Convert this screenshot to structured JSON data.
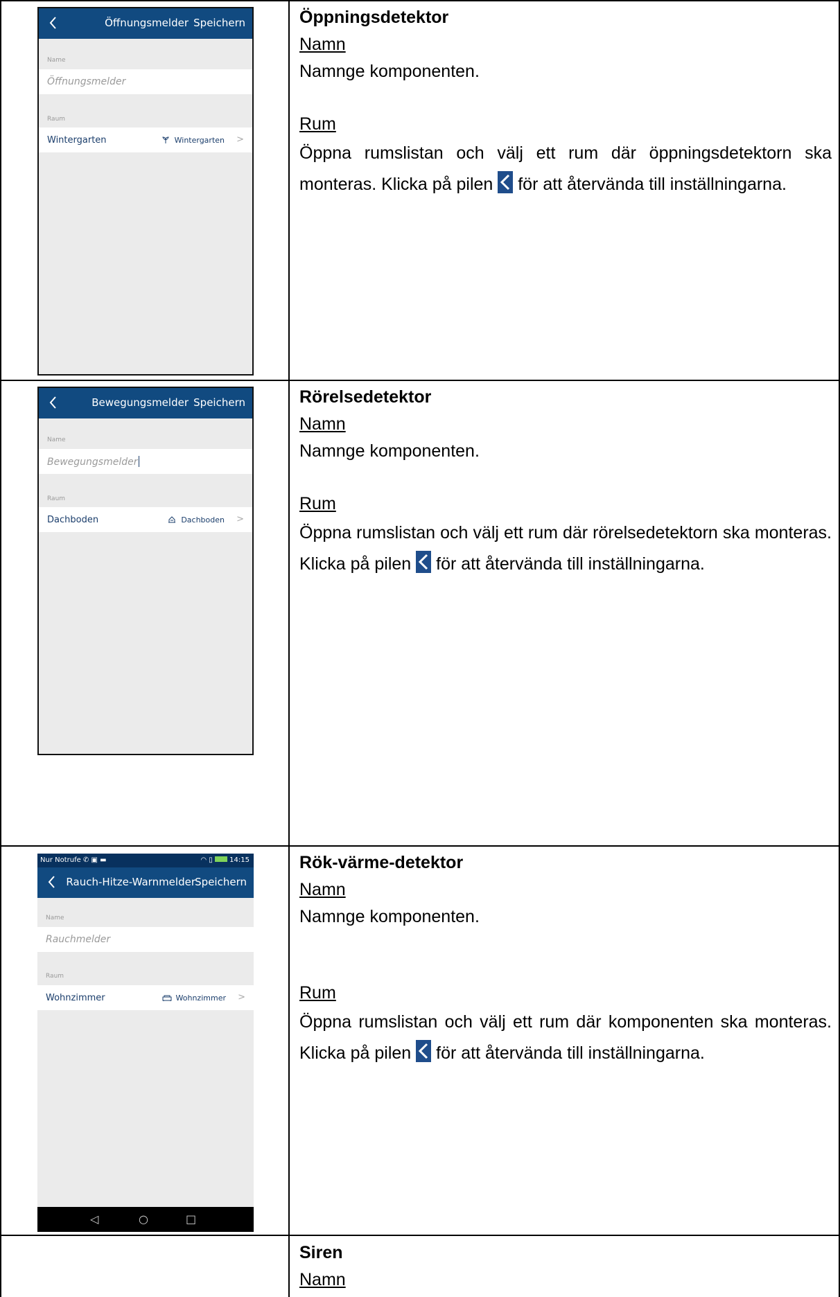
{
  "colors": {
    "accent": "#114a80",
    "icon_bg": "#1f4d8b"
  },
  "rows": [
    {
      "phone": {
        "title": "Öffnungsmelder",
        "save": "Speichern",
        "name_label": "Name",
        "name_value": "Öffnungsmelder",
        "room_label": "Raum",
        "room_name": "Wintergarten",
        "room_value": "Wintergarten",
        "room_icon": "plant-icon"
      },
      "heading": "Öppningsdetektor",
      "name_heading": "Namn",
      "name_text": "Namnge komponenten.",
      "room_heading": "Rum",
      "room_text_a": "Öppna rumslistan och välj ett rum där öppningsdetektorn ska monteras. Klicka på pilen",
      "room_text_b": "för att återvända till inställningarna."
    },
    {
      "phone": {
        "title": "Bewegungsmelder",
        "save": "Speichern",
        "name_label": "Name",
        "name_value": "Bewegungsmelder",
        "room_label": "Raum",
        "room_name": "Dachboden",
        "room_value": "Dachboden",
        "room_icon": "attic-icon"
      },
      "heading": "Rörelsedetektor",
      "name_heading": "Namn",
      "name_text": "Namnge komponenten.",
      "room_heading": "Rum",
      "room_text_a": "Öppna rumslistan och välj ett rum där rörelsedetektorn ska monteras. Klicka på pilen",
      "room_text_b": "för att återvända till inställningarna."
    },
    {
      "phone": {
        "status_left": "Nur Notrufe",
        "status_time": "14:15",
        "title": "Rauch-Hitze-Warnmelder",
        "save": "Speichern",
        "name_label": "Name",
        "name_value": "Rauchmelder",
        "room_label": "Raum",
        "room_name": "Wohnzimmer",
        "room_value": "Wohnzimmer",
        "room_icon": "sofa-icon",
        "nav_back": "◁",
        "nav_home": "○",
        "nav_recent": "□"
      },
      "heading": "Rök-värme-detektor",
      "name_heading": "Namn",
      "name_text": "Namnge komponenten.",
      "room_heading": "Rum",
      "room_text_a": "Öppna rumslistan och välj ett rum där komponenten ska monteras. Klicka på pilen",
      "room_text_b": "för att återvända till inställningarna."
    },
    {
      "heading": "Siren",
      "name_heading": "Namn"
    }
  ]
}
